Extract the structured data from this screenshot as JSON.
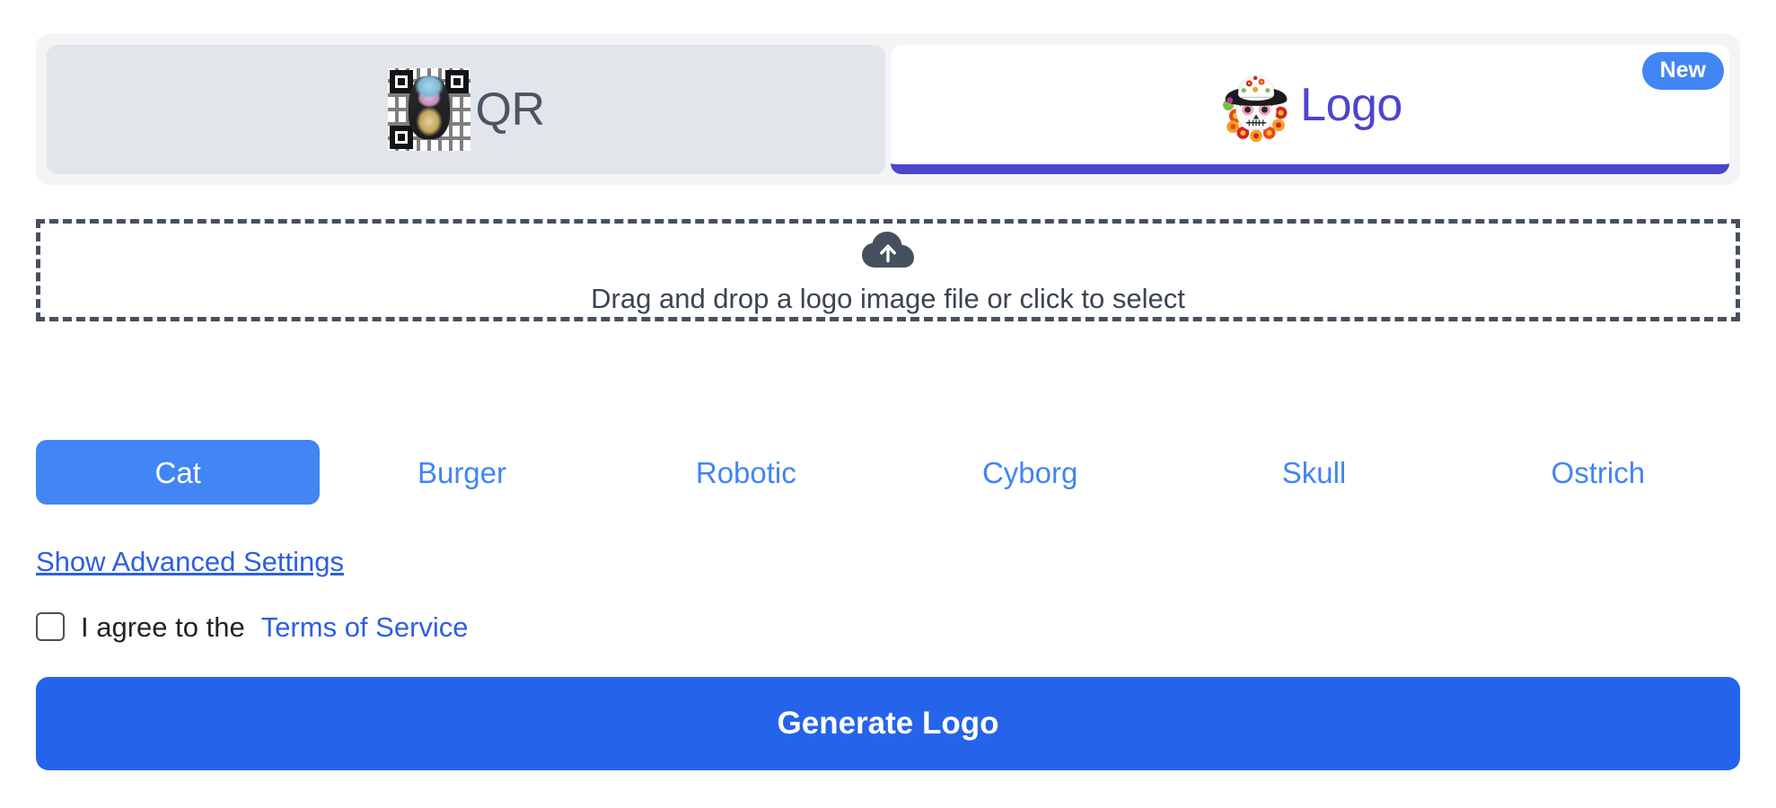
{
  "tabs": {
    "items": [
      {
        "id": "qr",
        "label": "QR",
        "icon": "qr-code-icon",
        "selected": false
      },
      {
        "id": "logo",
        "label": "Logo",
        "icon": "sugar-skull-logo-icon",
        "selected": true
      }
    ],
    "badge": "New"
  },
  "dropzone": {
    "icon": "cloud-upload-icon",
    "text": "Drag and drop a logo image file or click to select"
  },
  "styles": {
    "options": [
      {
        "label": "Cat",
        "selected": true
      },
      {
        "label": "Burger",
        "selected": false
      },
      {
        "label": "Robotic",
        "selected": false
      },
      {
        "label": "Cyborg",
        "selected": false
      },
      {
        "label": "Skull",
        "selected": false
      },
      {
        "label": "Ostrich",
        "selected": false
      }
    ]
  },
  "advanced": {
    "link_label": "Show Advanced Settings"
  },
  "agree": {
    "checked": false,
    "text": "I agree to the",
    "tos_label": "Terms of Service"
  },
  "actions": {
    "generate_label": "Generate Logo"
  },
  "colors": {
    "accent_blue": "#4285f4",
    "primary_blue": "#2563eb",
    "link_blue": "#2d5fe0",
    "logo_purple": "#4b45cd",
    "dropzone_border": "#46505e",
    "tab_inactive_bg": "#e2e6ea",
    "tabbar_bg": "#f3f4f6"
  }
}
